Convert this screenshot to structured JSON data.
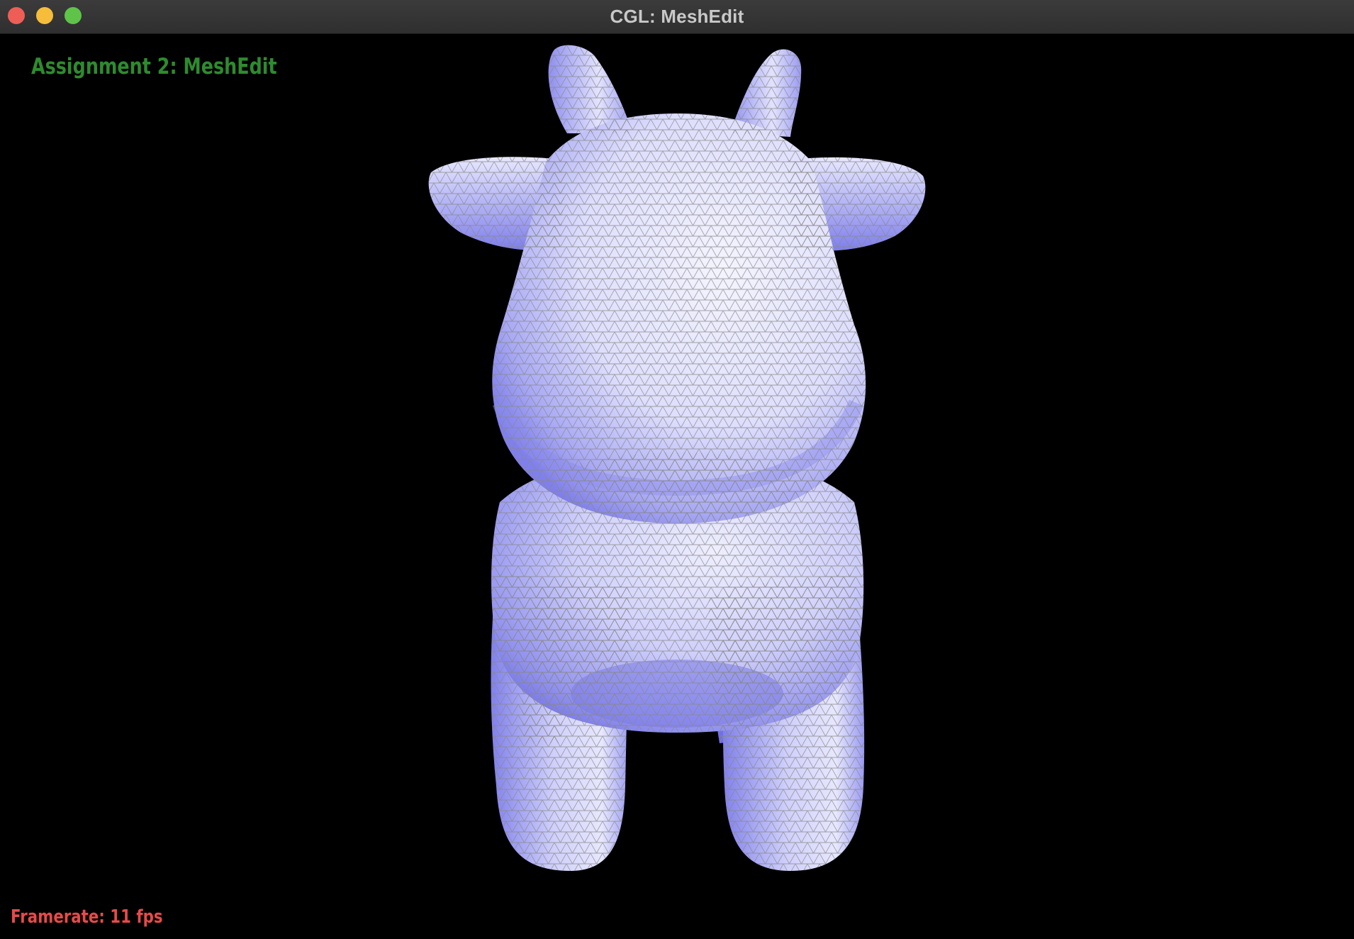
{
  "window": {
    "title": "CGL: MeshEdit",
    "buttons": {
      "close_color": "#ee5e57",
      "minimize_color": "#f6bd3b",
      "maximize_color": "#5fc34a"
    }
  },
  "overlay": {
    "heading": "Assignment 2: MeshEdit",
    "heading_color": "#2e8b2e",
    "framerate": "Framerate: 11 fps",
    "framerate_color": "#e64a4a"
  },
  "viewport": {
    "background": "#000000",
    "model": "cow-mesh",
    "shading": {
      "lit_color": "#eeeeff",
      "mid_color": "#b7b7f6",
      "shadow_color": "#7d7df0",
      "wire_color": "#8a8a8a"
    }
  }
}
